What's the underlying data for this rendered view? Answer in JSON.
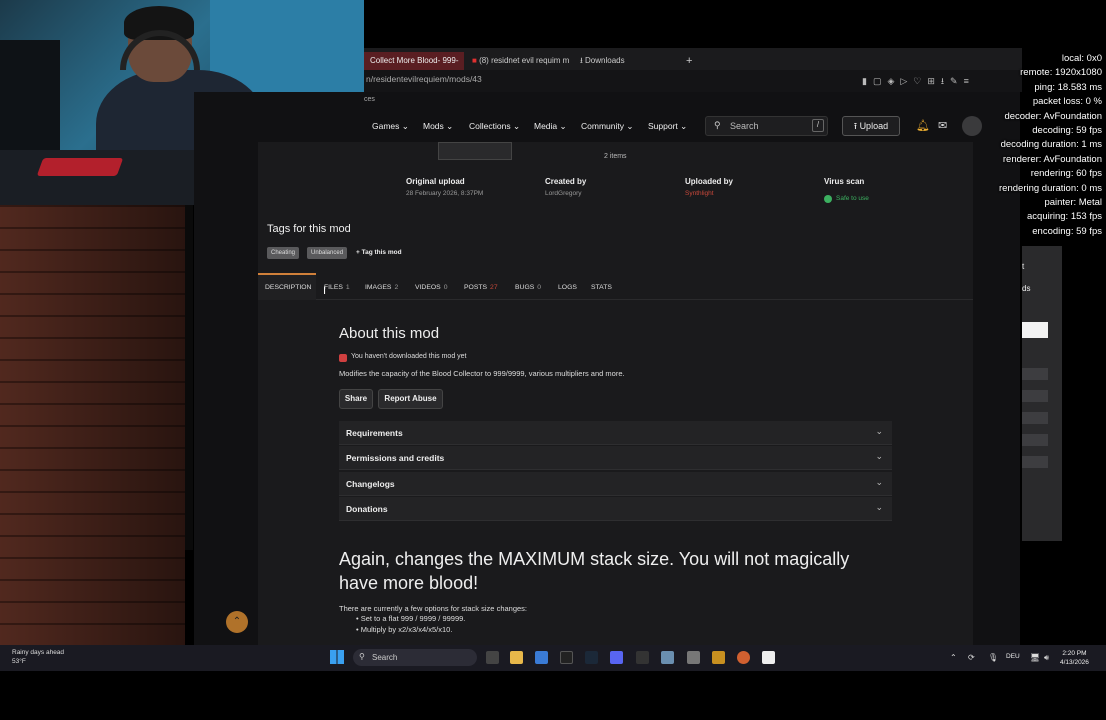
{
  "browser": {
    "tabs": [
      "Collect More Blood- 999-",
      "(8) residnet evil requim m",
      "Downloads"
    ],
    "new_tab": "+",
    "url": "n/residentevilrequiem/mods/43",
    "sub": "ces"
  },
  "nav": {
    "items": [
      "Games",
      "Mods",
      "Collections",
      "Media",
      "Community",
      "Support"
    ],
    "search_label": "Search",
    "search_shortcut": "/",
    "upload_label": "Upload"
  },
  "gallery": {
    "count": "2 items"
  },
  "meta": {
    "original_upload_label": "Original upload",
    "original_upload_value": "28 February 2026, 8:37PM",
    "created_by_label": "Created by",
    "created_by_value": "LordGregory",
    "uploaded_by_label": "Uploaded by",
    "uploaded_by_value": "Synthlight",
    "virus_scan_label": "Virus scan",
    "virus_scan_value": "Safe to use"
  },
  "tags": {
    "title": "Tags for this mod",
    "items": [
      "Cheating",
      "Unbalanced"
    ],
    "add_label": "+ Tag this mod"
  },
  "mod_tabs": [
    {
      "label": "DESCRIPTION",
      "count": ""
    },
    {
      "label": "FILES",
      "count": "1"
    },
    {
      "label": "IMAGES",
      "count": "2"
    },
    {
      "label": "VIDEOS",
      "count": "0"
    },
    {
      "label": "POSTS",
      "count": "27"
    },
    {
      "label": "BUGS",
      "count": "0"
    },
    {
      "label": "LOGS",
      "count": ""
    },
    {
      "label": "STATS",
      "count": ""
    }
  ],
  "about": {
    "title": "About this mod",
    "not_downloaded": "You haven't downloaded this mod yet",
    "summary": "Modifies the capacity of the Blood Collector to 999/9999, various multipliers and more.",
    "share_label": "Share",
    "report_label": "Report Abuse",
    "sections": [
      "Requirements",
      "Permissions and credits",
      "Changelogs",
      "Donations"
    ],
    "headline": "Again, changes the MAXIMUM stack size. You will not magically have more blood!",
    "options_intro": "There are currently a few options for stack size changes:",
    "options": [
      "Set to a flat 999 / 9999 / 99999.",
      "Multiply by x2/x3/x4/x5/x10."
    ]
  },
  "stats_overlay": [
    "local: 0x0",
    "remote: 1920x1080",
    "ping: 18.583 ms",
    "packet loss: 0 %",
    "decoder: AvFoundation",
    "decoding: 59 fps",
    "decoding duration: 1 ms",
    "renderer: AvFoundation",
    "rendering: 60 fps",
    "rendering duration: 0 ms",
    "painter: Metal",
    "acquiring: 153 fps",
    "encoding: 59 fps"
  ],
  "right_panel": [
    "t",
    "ds"
  ],
  "taskbar": {
    "weather_title": "Rainy days ahead",
    "weather_temp": "53°F",
    "search_label": "Search",
    "lang": "DEU",
    "time": "2:20 PM",
    "date": "4/13/2026"
  }
}
